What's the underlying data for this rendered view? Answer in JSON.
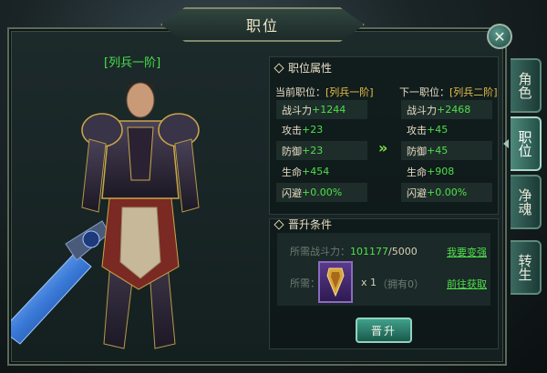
{
  "window": {
    "title": "职位"
  },
  "character": {
    "rank_label": "[列兵一阶]"
  },
  "attributes": {
    "section_title": "职位属性",
    "current": {
      "label": "当前职位：",
      "rank": "[列兵一阶]"
    },
    "next": {
      "label": "下一职位：",
      "rank": "[列兵二阶]"
    },
    "current_stats": [
      {
        "name": "战斗力",
        "value": "+1244"
      },
      {
        "name": "攻击",
        "value": "+23"
      },
      {
        "name": "防御",
        "value": "+23"
      },
      {
        "name": "生命",
        "value": "+454"
      },
      {
        "name": "闪避",
        "value": "+0.00%"
      }
    ],
    "next_stats": [
      {
        "name": "战斗力",
        "value": "+2468"
      },
      {
        "name": "攻击",
        "value": "+45"
      },
      {
        "name": "防御",
        "value": "+45"
      },
      {
        "name": "生命",
        "value": "+908"
      },
      {
        "name": "闪避",
        "value": "+0.00%"
      }
    ],
    "arrow": "»"
  },
  "requirements": {
    "section_title": "晋升条件",
    "power_label": "所需战斗力：",
    "power_current": "101177",
    "power_required": "/5000",
    "power_link": "我要变强",
    "item_label": "所需：",
    "item_count": "x 1",
    "item_owned": "（拥有0）",
    "item_link": "前往获取",
    "promote_button": "晋升"
  },
  "tabs": [
    {
      "label": "角色",
      "active": false
    },
    {
      "label": "职位",
      "active": true
    },
    {
      "label": "净魂",
      "active": false
    },
    {
      "label": "转生",
      "active": false
    }
  ],
  "icons": {
    "close": "close-icon",
    "item": "badge-item-icon",
    "section": "diamond-icon"
  },
  "colors": {
    "accent_green": "#4ee04a",
    "rank_gold": "#e7c24a",
    "item_purple": "#5a3a8a"
  }
}
